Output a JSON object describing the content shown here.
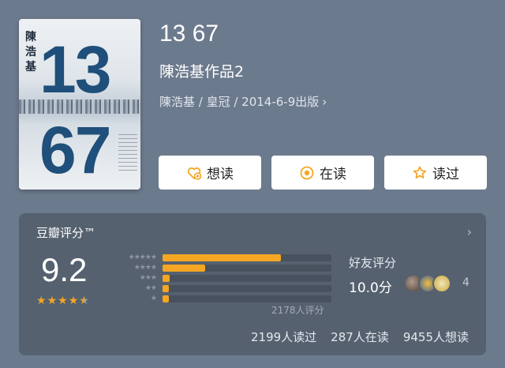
{
  "cover": {
    "author_vertical": "陳浩基",
    "number_top": "13",
    "number_bottom": "67"
  },
  "book": {
    "title": "13 67",
    "subtitle": "陳浩基作品2",
    "meta": "陳浩基 / 皇冠 / 2014-6-9出版",
    "meta_chevron": "›"
  },
  "actions": {
    "want": {
      "label": "想读",
      "icon": "heart-plus-icon"
    },
    "reading": {
      "label": "在读",
      "icon": "dot-circle-icon"
    },
    "read": {
      "label": "读过",
      "icon": "star-outline-icon"
    }
  },
  "rating": {
    "title": "豆瓣评分™",
    "chevron": "›",
    "score": "9.2",
    "stars_fraction": 0.92,
    "star_labels": [
      "★★★★★",
      "★★★★",
      "★★★",
      "★★",
      "★"
    ],
    "distribution": [
      0.7,
      0.25,
      0.04,
      0.02,
      0.01
    ],
    "count_text": "2178人评分",
    "friends": {
      "label": "好友评分",
      "score": "10.0分",
      "count": "4"
    }
  },
  "stats": {
    "read": "2199人读过",
    "reading": "287人在读",
    "want": "9455人想读"
  },
  "colors": {
    "accent": "#f5a623",
    "background": "#6c7a8d",
    "panel": "#56616f",
    "bar_track": "#48525e"
  }
}
